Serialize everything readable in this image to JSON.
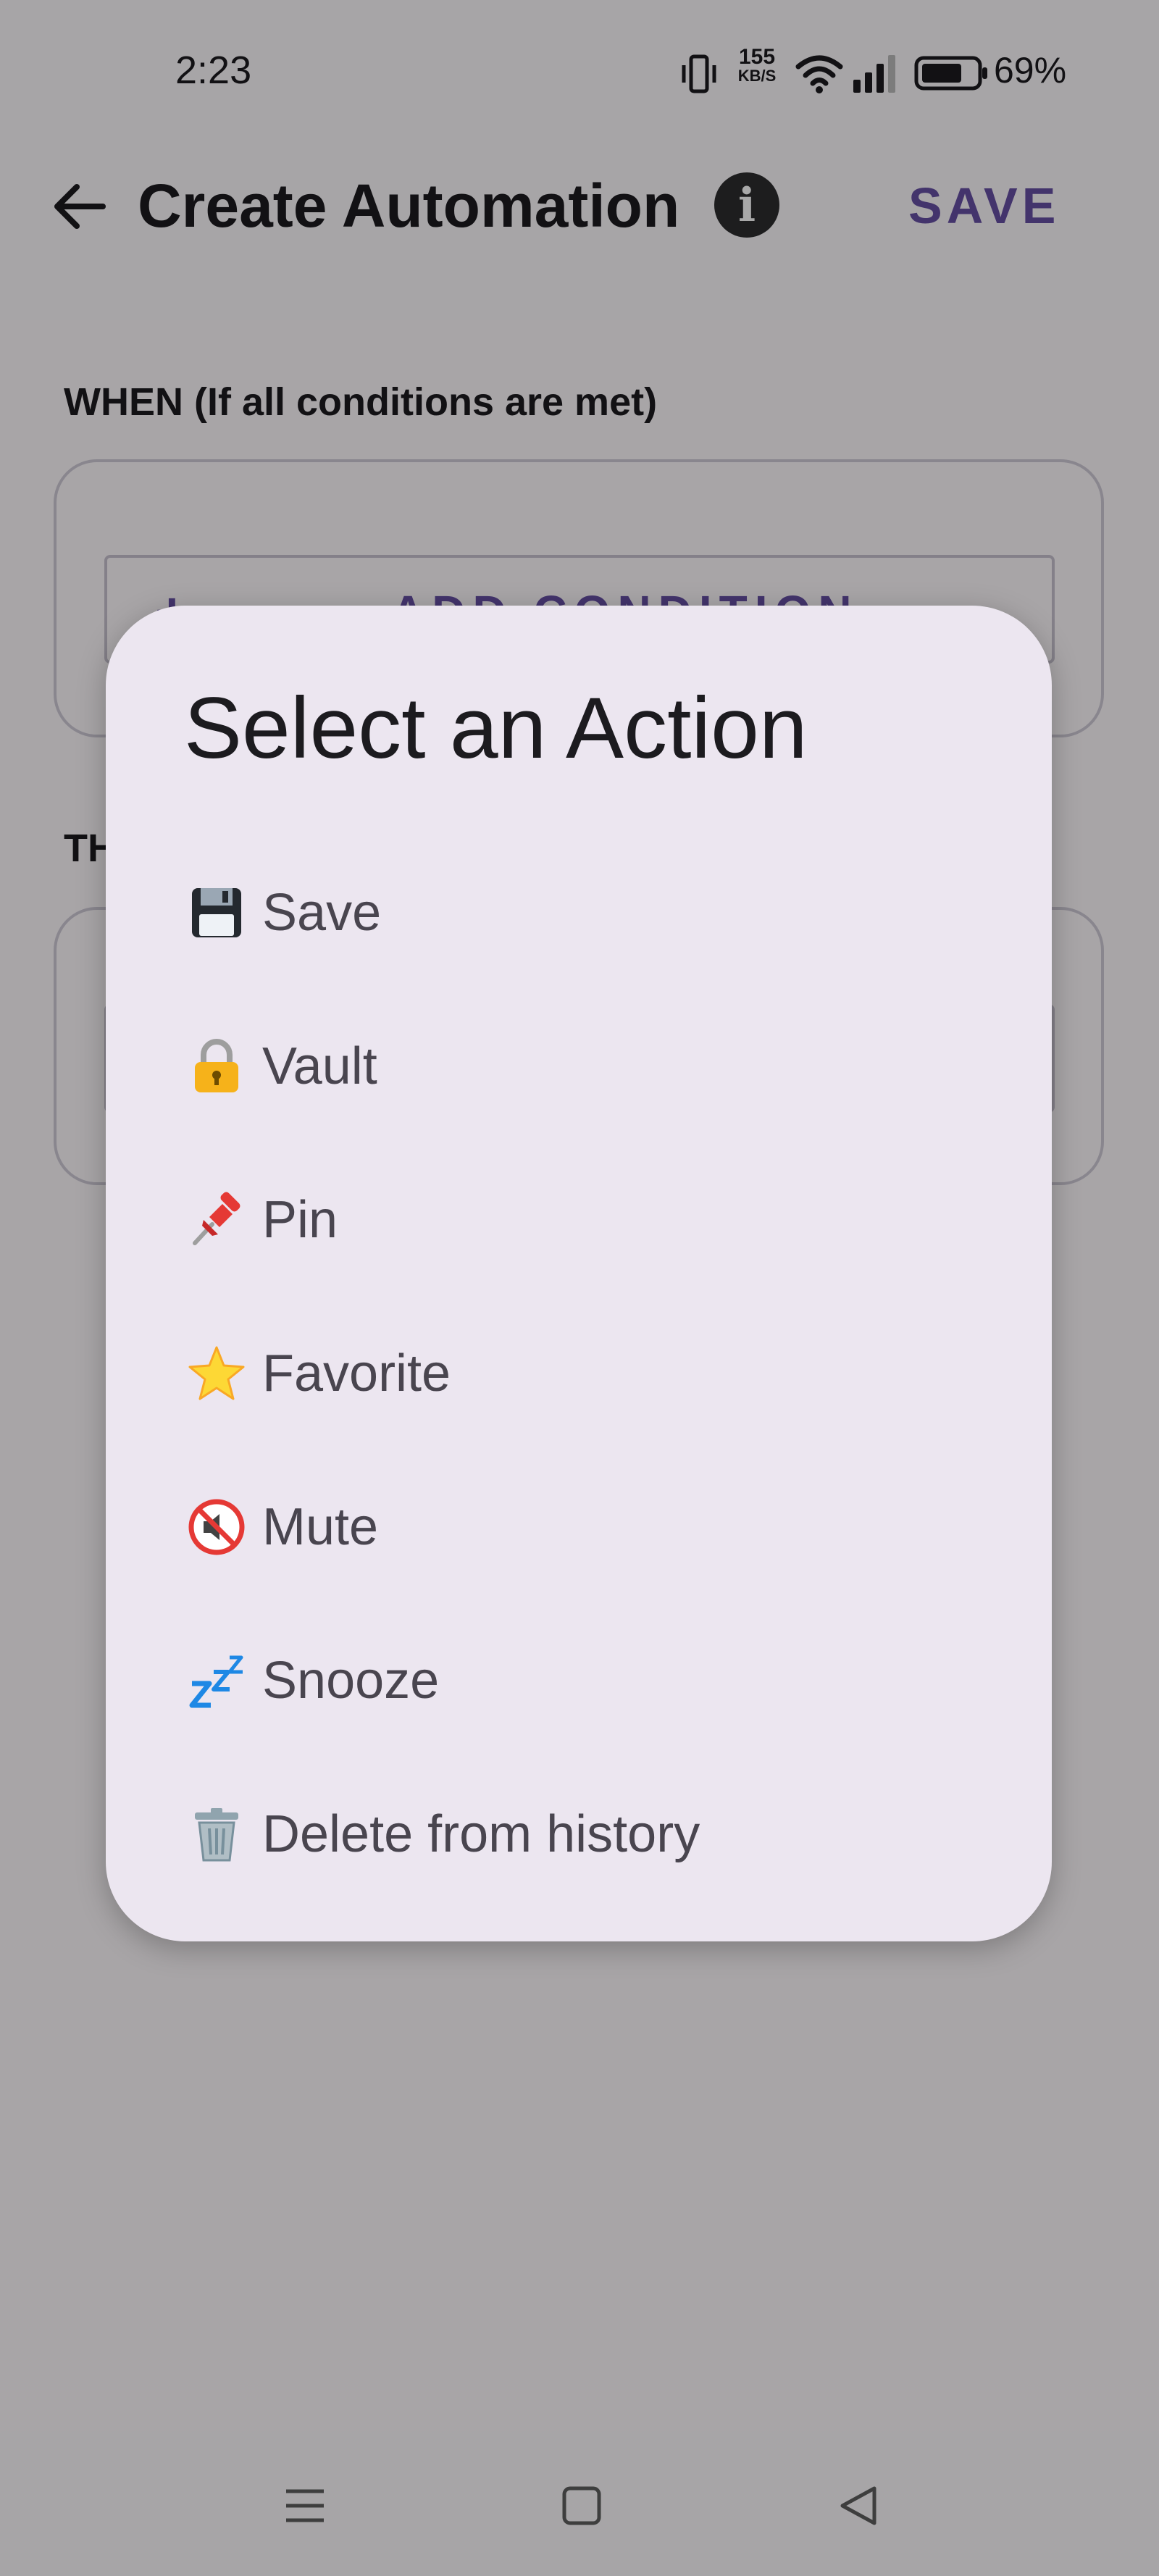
{
  "status_bar": {
    "time": "2:23",
    "net_speed_value": "155",
    "net_speed_unit": "KB/S",
    "battery_percent": "69%",
    "icons": [
      "vibrate-icon",
      "wifi-icon",
      "signal-icon",
      "battery-icon"
    ]
  },
  "app_bar": {
    "title": "Create Automation",
    "save_label": "SAVE",
    "info_glyph": "i",
    "accent_color": "#6750a4"
  },
  "when_section": {
    "label": "WHEN (If all conditions are met)",
    "add_button_plus": "+",
    "add_button_label": "ADD CONDITION"
  },
  "then_section": {
    "label": "TH"
  },
  "dialog": {
    "title": "Select an Action",
    "items": [
      {
        "emoji": "💾",
        "label": "Save",
        "icon": "floppy-disk-icon"
      },
      {
        "emoji": "🔒",
        "label": "Vault",
        "icon": "lock-icon"
      },
      {
        "emoji": "📌",
        "label": "Pin",
        "icon": "pushpin-icon"
      },
      {
        "emoji": "⭐",
        "label": "Favorite",
        "icon": "star-icon"
      },
      {
        "emoji": "🔇",
        "label": "Mute",
        "icon": "muted-speaker-icon"
      },
      {
        "emoji": "💤",
        "label": "Snooze",
        "icon": "zzz-icon"
      },
      {
        "emoji": "🗑️",
        "label": "Delete from history",
        "icon": "trash-icon"
      }
    ]
  },
  "nav_bar": {
    "buttons": [
      "menu-icon",
      "home-icon",
      "back-triangle-icon"
    ]
  }
}
